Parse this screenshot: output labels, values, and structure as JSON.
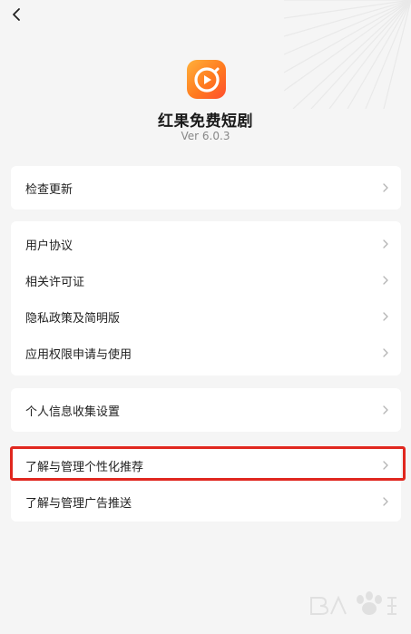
{
  "header": {
    "back_icon": "chevron-left-icon"
  },
  "app": {
    "name": "红果免费短剧",
    "version": "Ver 6.0.3",
    "icon": "play-icon",
    "icon_gradient": [
      "#ffb13b",
      "#ff7a1f",
      "#ff4d2e"
    ]
  },
  "sections": [
    {
      "items": [
        {
          "label": "检查更新"
        }
      ]
    },
    {
      "items": [
        {
          "label": "用户协议"
        },
        {
          "label": "相关许可证"
        },
        {
          "label": "隐私政策及简明版"
        },
        {
          "label": "应用权限申请与使用"
        }
      ]
    },
    {
      "items": [
        {
          "label": "个人信息收集设置"
        }
      ]
    },
    {
      "items": [
        {
          "label": "了解与管理个性化推荐"
        },
        {
          "label": "了解与管理广告推送"
        }
      ]
    }
  ],
  "annotation": {
    "highlight_color": "#e0271f"
  },
  "watermark": {
    "logo": "baidu-paw-icon"
  }
}
